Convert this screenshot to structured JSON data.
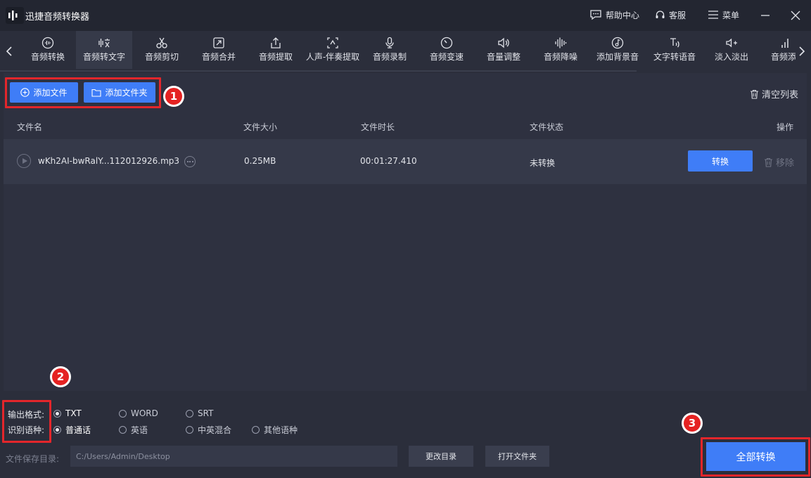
{
  "window": {
    "title": "迅捷音频转换器",
    "help": "帮助中心",
    "service": "客服",
    "menu": "菜单"
  },
  "toolbar": {
    "tools": [
      {
        "label": "音频转换",
        "icon": "audio-convert-icon",
        "active": false
      },
      {
        "label": "音频转文字",
        "icon": "audio-to-text-icon",
        "active": true
      },
      {
        "label": "音频剪切",
        "icon": "scissors-icon",
        "active": false
      },
      {
        "label": "音频合并",
        "icon": "merge-icon",
        "active": false
      },
      {
        "label": "音频提取",
        "icon": "extract-icon",
        "active": false
      },
      {
        "label": "人声-伴奏提取",
        "icon": "vocal-extract-icon",
        "active": false
      },
      {
        "label": "音频录制",
        "icon": "microphone-icon",
        "active": false
      },
      {
        "label": "音频变速",
        "icon": "speed-icon",
        "active": false
      },
      {
        "label": "音量调整",
        "icon": "volume-icon",
        "active": false
      },
      {
        "label": "音频降噪",
        "icon": "noise-reduction-icon",
        "active": false
      },
      {
        "label": "添加背景音",
        "icon": "background-music-icon",
        "active": false
      },
      {
        "label": "文字转语音",
        "icon": "text-to-speech-icon",
        "active": false
      },
      {
        "label": "淡入淡出",
        "icon": "fade-icon",
        "active": false
      },
      {
        "label": "音频添",
        "icon": "audio-add-icon",
        "active": false
      }
    ]
  },
  "actions": {
    "add_file": "添加文件",
    "add_folder": "添加文件夹",
    "clear_list": "清空列表"
  },
  "table": {
    "headers": {
      "name": "文件名",
      "size": "文件大小",
      "duration": "文件时长",
      "status": "文件状态",
      "ops": "操作"
    },
    "rows": [
      {
        "name": "wKh2AI-bwRalY...112012926.mp3",
        "size": "0.25MB",
        "duration": "00:01:27.410",
        "status": "未转换",
        "convert": "转换",
        "remove": "移除"
      }
    ]
  },
  "output": {
    "format_label": "输出格式:",
    "formats": [
      "TXT",
      "WORD",
      "SRT"
    ],
    "selected_format": "TXT",
    "language_label": "识别语种:",
    "languages": [
      "普通话",
      "英语",
      "中英混合",
      "其他语种"
    ],
    "selected_language": "普通话"
  },
  "save": {
    "label": "文件保存目录:",
    "path": "C:/Users/Admin/Desktop",
    "change_dir": "更改目录",
    "open_folder": "打开文件夹",
    "convert_all": "全部转换"
  },
  "badges": [
    "1",
    "2",
    "3"
  ],
  "colors": {
    "accent": "#3f7df7",
    "annotation": "#e3262b"
  }
}
